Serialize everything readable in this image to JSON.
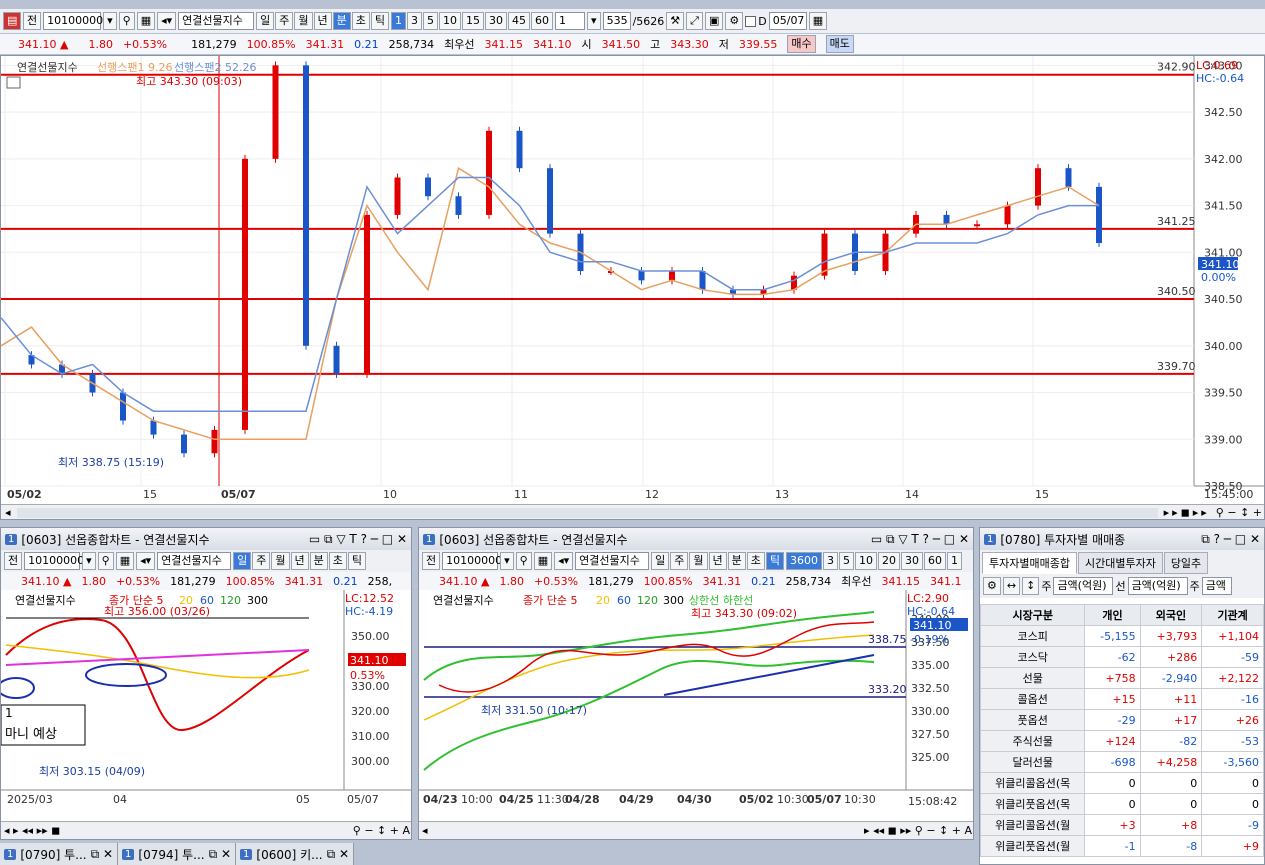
{
  "main": {
    "toolbar": {
      "type_label": "전",
      "code": "10100000",
      "name": "연결선물지수",
      "periods": [
        "일",
        "주",
        "월",
        "년",
        "분",
        "초",
        "틱"
      ],
      "intervals": [
        "1",
        "3",
        "5",
        "10",
        "15",
        "30",
        "45",
        "60"
      ],
      "unit": "1",
      "count": "535",
      "total": "/5626",
      "date": "05/07",
      "d_label": "D"
    },
    "quote": {
      "price": "341.10 ▲",
      "change": "1.80",
      "rate": "+0.53%",
      "volume": "181,279",
      "vol_ratio": "100.85%",
      "basis": "341.31",
      "basis_diff": "0.21",
      "oi": "258,734",
      "best_label": "최우선",
      "ask": "341.15",
      "bid": "341.10",
      "open_label": "시",
      "open": "341.50",
      "high_label": "고",
      "high": "343.30",
      "low_label": "저",
      "low": "339.55",
      "buy": "매수",
      "sell": "매도"
    },
    "chart": {
      "legend_name": "연결선물지수",
      "legend_span1": "선행스팬1 9.26",
      "legend_span2": "선행스팬2 52.26",
      "high_note": "최고 343.30 (09:03)",
      "low_note": "최저 338.75 (15:19)",
      "lc": "LC:0.69",
      "hc": "HC:-0.64",
      "current": "341.10",
      "current_pct": "0.00%",
      "y_ticks": [
        "343.00",
        "342.50",
        "342.00",
        "341.50",
        "341.00",
        "340.50",
        "340.00",
        "339.50",
        "339.00",
        "338.50"
      ],
      "h_lines": [
        "342.90",
        "341.25",
        "340.50",
        "339.70"
      ],
      "x_labels": [
        "05/02",
        "15",
        "05/07",
        "10",
        "11",
        "12",
        "13",
        "14",
        "15"
      ],
      "time": "15:45:00"
    }
  },
  "chart_data": {
    "type": "line",
    "title": "연결선물지수",
    "ylim": [
      338.5,
      343.1
    ],
    "series": [
      {
        "name": "연결선물지수",
        "values": [
          339.9,
          339.8,
          339.7,
          339.5,
          339.2,
          339.05,
          338.85,
          339.1,
          342.0,
          343.0,
          340.0,
          339.7,
          341.4,
          341.8,
          341.6,
          341.4,
          342.3,
          341.9,
          341.2,
          340.8,
          340.8,
          340.7,
          340.8,
          340.6,
          340.55,
          340.6,
          340.75,
          341.2,
          340.8,
          341.2,
          341.4,
          341.3,
          341.3,
          341.5,
          341.9,
          341.7,
          341.1
        ]
      },
      {
        "name": "선행스팬1",
        "values": [
          340.0,
          340.2,
          339.8,
          339.6,
          339.4,
          339.2,
          339.1,
          339.0,
          339.0,
          339.0,
          339.0,
          340.5,
          341.5,
          341.0,
          340.6,
          341.9,
          341.7,
          341.3,
          341.1,
          341.0,
          340.8,
          340.6,
          340.7,
          340.6,
          340.55,
          340.55,
          340.6,
          340.8,
          340.9,
          341.0,
          341.3,
          341.3,
          341.4,
          341.5,
          341.6,
          341.7,
          341.5
        ]
      },
      {
        "name": "선행스팬2",
        "values": [
          340.3,
          339.9,
          339.7,
          339.8,
          339.5,
          339.3,
          339.3,
          339.3,
          339.3,
          339.3,
          339.3,
          340.5,
          341.7,
          341.2,
          341.5,
          341.8,
          341.8,
          341.5,
          341.0,
          340.9,
          340.9,
          340.8,
          340.8,
          340.8,
          340.6,
          340.6,
          340.7,
          340.9,
          341.0,
          341.0,
          341.1,
          341.1,
          341.1,
          341.2,
          341.4,
          341.5,
          341.5
        ]
      }
    ]
  },
  "left": {
    "title": "[0603] 선옵종합차트 - 연결선물지수",
    "code": "10100000",
    "name": "연결선물지수",
    "periods": [
      "일",
      "주",
      "월",
      "년",
      "분",
      "초",
      "틱"
    ],
    "quote": {
      "price": "341.10 ▲",
      "change": "1.80",
      "rate": "+0.53%",
      "volume": "181,279",
      "vol_ratio": "100.85%",
      "basis": "341.31",
      "basis_diff": "0.21",
      "oi": "258,"
    },
    "legend_name": "연결선물지수",
    "legend_ma": "종가 단순 5",
    "ma_periods": [
      "20",
      "60",
      "120",
      "300"
    ],
    "high_note": "최고 356.00 (03/26)",
    "low_note": "최저 303.15 (04/09)",
    "lc": "LC:12.52",
    "hc": "HC:-4.19",
    "current": "341.10",
    "current_pct": "0.53%",
    "y_ticks": [
      "350.00",
      "340.00",
      "330.00",
      "320.00",
      "310.00",
      "300.00"
    ],
    "x_labels": [
      "2025/03",
      "04",
      "05",
      "05/07"
    ],
    "note_text": "마니 예상",
    "note_head": "1"
  },
  "mid": {
    "title": "[0603] 선옵종합차트 - 연결선물지수",
    "code": "10100000",
    "name": "연결선물지수",
    "periods": [
      "일",
      "주",
      "월",
      "년",
      "분",
      "초",
      "틱"
    ],
    "intervals": [
      "3600",
      "3",
      "5",
      "10",
      "20",
      "30",
      "60",
      "1"
    ],
    "quote": {
      "price": "341.10 ▲",
      "change": "1.80",
      "rate": "+0.53%",
      "volume": "181,279",
      "vol_ratio": "100.85%",
      "basis": "341.31",
      "basis_diff": "0.21",
      "oi": "258,734",
      "best_label": "최우선",
      "ask": "341.15",
      "bid": "341.1"
    },
    "legend_name": "연결선물지수",
    "legend_ma": "종가 단순 5",
    "ma_periods": [
      "20",
      "60",
      "120",
      "300"
    ],
    "legend_band": "상한선 하한선",
    "high_note": "최고 343.30 (09:02)",
    "low_note": "최저 331.50 (10:17)",
    "lc": "LC:2.90",
    "hc": "HC:-0.64",
    "current": "341.10",
    "current_pct": "-0.19%",
    "level1": "338.75",
    "level2": "333.20",
    "y_ticks": [
      "340.00",
      "337.50",
      "335.00",
      "332.50",
      "330.00",
      "327.50",
      "325.00"
    ],
    "x_labels": [
      "04/23",
      "10:00",
      "04/25",
      "11:30",
      "04/28",
      "04/29",
      "04/30",
      "05/02",
      "10:30",
      "05/07",
      "10:30"
    ],
    "time": "15:08:42"
  },
  "right": {
    "title": "[0780] 투자자별 매매종",
    "tabs": [
      "투자자별매매종합",
      "시간대별투자자",
      "당일추"
    ],
    "select1": "금액(억원)",
    "select2": "금액(억원)",
    "select3": "금액",
    "label_ju": "주",
    "label_seon": "선",
    "headers": [
      "시장구분",
      "개인",
      "외국인",
      "기관계"
    ],
    "rows": [
      {
        "name": "코스피",
        "v": [
          "-5,155",
          "+3,793",
          "+1,104"
        ]
      },
      {
        "name": "코스닥",
        "v": [
          "-62",
          "+286",
          "-59"
        ]
      },
      {
        "name": "선물",
        "v": [
          "+758",
          "-2,940",
          "+2,122"
        ]
      },
      {
        "name": "콜옵션",
        "v": [
          "+15",
          "+11",
          "-16"
        ]
      },
      {
        "name": "풋옵션",
        "v": [
          "-29",
          "+17",
          "+26"
        ]
      },
      {
        "name": "주식선물",
        "v": [
          "+124",
          "-82",
          "-53"
        ]
      },
      {
        "name": "달러선물",
        "v": [
          "-698",
          "+4,258",
          "-3,560"
        ]
      },
      {
        "name": "위클리콜옵션(목",
        "v": [
          "0",
          "0",
          "0"
        ]
      },
      {
        "name": "위클리풋옵션(목",
        "v": [
          "0",
          "0",
          "0"
        ]
      },
      {
        "name": "위클리콜옵션(월",
        "v": [
          "+3",
          "+8",
          "-9"
        ]
      },
      {
        "name": "위클리풋옵션(월",
        "v": [
          "-1",
          "-8",
          "+9"
        ]
      }
    ]
  },
  "taskbar": [
    "[0790] 투...",
    "[0794] 투...",
    "[0600] 키..."
  ],
  "colors": {
    "up": "#e00000",
    "down": "#1a56c8",
    "span1": "#e8a060",
    "span2": "#6b8fd6",
    "hline": "#e00000",
    "accent": "#3a7ad8"
  }
}
